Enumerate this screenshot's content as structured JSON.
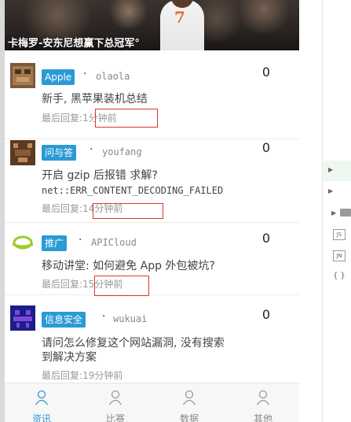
{
  "banner": {
    "title": "卡梅罗-安东尼想赢下总冠军",
    "jersey_number": "7"
  },
  "topics": [
    {
      "tag": "Apple",
      "author": "olaola",
      "count": "0",
      "title": "新手, 黑苹果装机总结",
      "reply_label": "最后回复:",
      "reply_time": "1分钟前"
    },
    {
      "tag": "问与答",
      "author": "youfang",
      "count": "0",
      "title": "开启 gzip 后报错 求解?",
      "title2": "net::ERR_CONTENT_DECODING_FAILED",
      "reply_label": "最后回复:",
      "reply_time": "14分钟前"
    },
    {
      "tag": "推广",
      "author": "APICloud",
      "count": "0",
      "title": "移动讲堂: 如何避免 App 外包被坑?",
      "reply_label": "最后回复:",
      "reply_time": "15分钟前"
    },
    {
      "tag": "信息安全",
      "author": "wukuai",
      "count": "0",
      "title": "请问怎么修复这个网站漏洞, 没有搜索",
      "title2": "到解决方案",
      "reply_label": "最后回复:",
      "reply_time": "19分钟前"
    }
  ],
  "tabs": [
    {
      "label": "资讯",
      "active": true
    },
    {
      "label": "比赛",
      "active": false
    },
    {
      "label": "数据",
      "active": false
    },
    {
      "label": "其他",
      "active": false
    }
  ],
  "side_panel": {
    "file_js": "JS",
    "file_json": "JN",
    "braces": "{ }"
  },
  "colors": {
    "accent": "#2b9ad6",
    "highlight_box": "#e03434"
  }
}
